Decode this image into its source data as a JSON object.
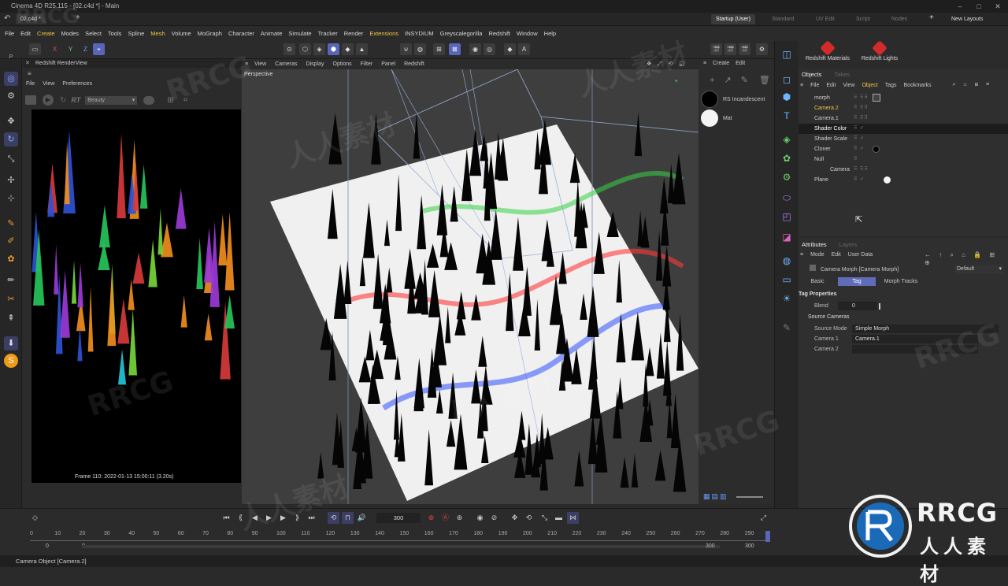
{
  "window": {
    "title": "Cinema 4D R25.115 - [02.c4d *] - Main"
  },
  "tabbar": {
    "doc_tab": "02.c4d *",
    "layouts": [
      "Startup (User)",
      "Standard",
      "UV Edit",
      "Script",
      "Nodes"
    ],
    "new_layouts": "New Layouts"
  },
  "menu": [
    "File",
    "Edit",
    "Create",
    "Modes",
    "Select",
    "Tools",
    "Spline",
    "Mesh",
    "Volume",
    "MoGraph",
    "Character",
    "Animate",
    "Simulate",
    "Tracker",
    "Render",
    "Extensions",
    "INSYDIUM",
    "Greyscalegorilla",
    "Redshift",
    "Window",
    "Help"
  ],
  "toolbar": {
    "axes": [
      "X",
      "Y",
      "Z"
    ]
  },
  "renderview": {
    "title": "Redshift RenderView",
    "menu": [
      "File",
      "View",
      "Preferences"
    ],
    "rt_label": "RT",
    "aov": "Beauty",
    "caption": "Frame  110:  2022-01-13  15:00:11  (3.20s)"
  },
  "viewport": {
    "menu": [
      "View",
      "Cameras",
      "Display",
      "Options",
      "Filter",
      "Panel",
      "Redshift"
    ],
    "label": "Perspective"
  },
  "materials": {
    "menu": [
      "Create",
      "Edit"
    ],
    "items": [
      {
        "name": "RS Incandescent",
        "color": "#000000"
      },
      {
        "name": "Mat",
        "color": "#f4f4f4"
      }
    ]
  },
  "redshift_panel": {
    "materials": "Redshift Materials",
    "lights": "Redshift Lights"
  },
  "objects": {
    "tabs": [
      "Objects",
      "Takes"
    ],
    "menu": [
      "File",
      "Edit",
      "View",
      "Object",
      "Tags",
      "Bookmarks"
    ],
    "rows": [
      {
        "name": "morph",
        "color": "#cfcfcf"
      },
      {
        "name": "Camera.2",
        "color": "#f0c24c"
      },
      {
        "name": "Camera.1",
        "color": "#cfcfcf"
      },
      {
        "name": "Shader Color",
        "color": "#ffffff"
      },
      {
        "name": "Shader Scale",
        "color": "#cfcfcf"
      },
      {
        "name": "Cloner",
        "color": "#cfcfcf"
      },
      {
        "name": "Null",
        "color": "#cfcfcf"
      },
      {
        "name": "Camera",
        "color": "#cfcfcf"
      },
      {
        "name": "Plane",
        "color": "#cfcfcf"
      }
    ]
  },
  "attributes": {
    "tabs": [
      "Attributes",
      "Layers"
    ],
    "menu": [
      "Mode",
      "Edit",
      "User Data"
    ],
    "object": "Camera Morph [Camera Morph]",
    "preset": "Default",
    "subtabs": [
      "Basic",
      "Tag",
      "Morph Tracks"
    ],
    "section": "Tag Properties",
    "blend_label": "Blend",
    "blend_value": "0",
    "group": "Source Cameras",
    "source_mode_label": "Source Mode",
    "source_mode": "Simple Morph",
    "camera1_label": "Camera 1",
    "camera1": "Camera.1",
    "camera2_label": "Camera 2",
    "camera2": ""
  },
  "timeline": {
    "end_frame": "300",
    "ticks": [
      "0",
      "10",
      "20",
      "30",
      "40",
      "50",
      "60",
      "70",
      "80",
      "90",
      "100",
      "110",
      "120",
      "130",
      "140",
      "150",
      "160",
      "170",
      "180",
      "190",
      "200",
      "210",
      "220",
      "230",
      "240",
      "250",
      "260",
      "270",
      "280",
      "290"
    ],
    "range_start": "0",
    "range_start2": "0",
    "range_end": "300",
    "range_end2": "300"
  },
  "status": {
    "text": "Camera Object [Camera.2]"
  },
  "logo": {
    "top": "RRCG",
    "bottom": "人人素材"
  },
  "watermark": {
    "text1": "RRCG",
    "text2": "人人素材"
  }
}
